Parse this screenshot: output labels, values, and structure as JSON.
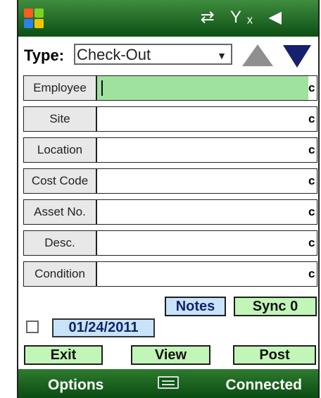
{
  "status_bar": {
    "icons": [
      "sync-arrows-icon",
      "signal-x-icon",
      "speaker-icon"
    ]
  },
  "form": {
    "type_label": "Type:",
    "type_value": "Check-Out",
    "fields": [
      "Employee",
      "Site",
      "Location",
      "Cost Code",
      "Asset No.",
      "Desc.",
      "Condition"
    ],
    "c_label": "c"
  },
  "actions": {
    "notes": "Notes",
    "sync": "Sync 0",
    "date": "01/24/2011",
    "exit": "Exit",
    "view": "View",
    "post": "Post"
  },
  "softkeys": {
    "left": "Options",
    "right": "Connected"
  },
  "colors": {
    "bar_green": "#0c4f14",
    "active_field": "#9ee29e",
    "blue_button": "#c8e3fa",
    "green_button": "#c2f5b8",
    "navy": "#15216d"
  }
}
